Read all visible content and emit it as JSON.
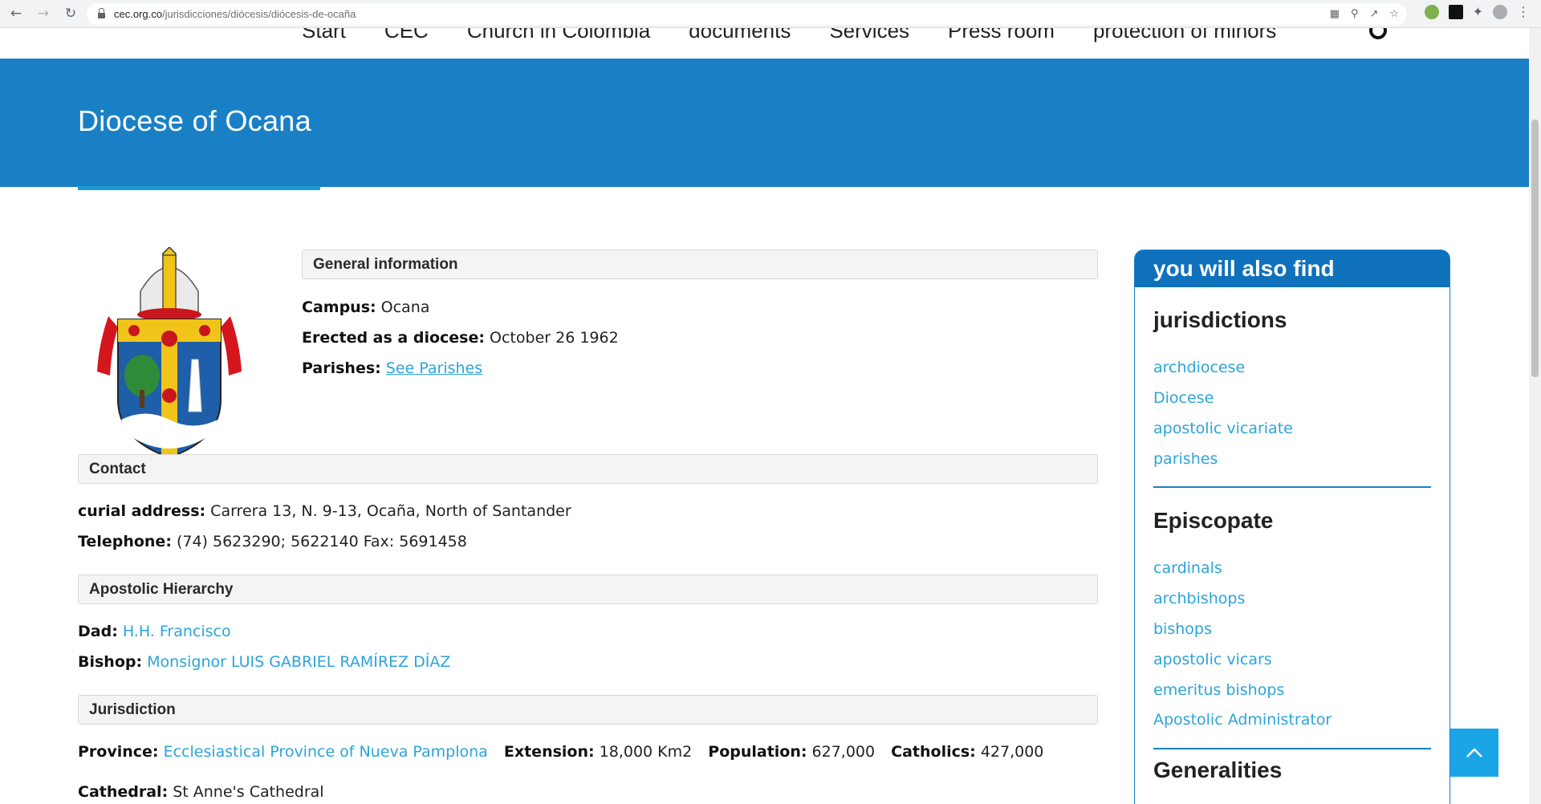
{
  "browser": {
    "url_host": "cec.org.co",
    "url_path": "/jurisdicciones/diócesis/diócesis-de-ocaña"
  },
  "nav": {
    "items": [
      "Start",
      "CEC",
      "Church in Colombia",
      "documents",
      "Services",
      "Press room",
      "protection of minors"
    ]
  },
  "hero": {
    "title": "Diocese of Ocana"
  },
  "general": {
    "heading": "General information",
    "campus_label": "Campus:",
    "campus_value": "Ocana",
    "erected_label": "Erected as a diocese:",
    "erected_value": "October 26 1962",
    "parishes_label": "Parishes:",
    "parishes_link": "See Parishes"
  },
  "contact": {
    "heading": "Contact",
    "address_label": "curial address:",
    "address_value": "Carrera 13, N. 9-13, Ocaña, North of Santander",
    "phone_label": "Telephone:",
    "phone_value": "(74) 5623290; 5622140 Fax: 5691458"
  },
  "hierarchy": {
    "heading": "Apostolic Hierarchy",
    "dad_label": "Dad:",
    "dad_value": "H.H. Francisco",
    "bishop_label": "Bishop:",
    "bishop_value": "Monsignor LUIS GABRIEL RAMÍREZ DÍAZ"
  },
  "jurisdiction": {
    "heading": "Jurisdiction",
    "province_label": "Province:",
    "province_value": "Ecclesiastical Province of Nueva Pamplona",
    "extension_label": "Extension:",
    "extension_value": "18,000 Km2",
    "population_label": "Population:",
    "population_value": "627,000",
    "catholics_label": "Catholics:",
    "catholics_value": "427,000",
    "cathedral_label": "Cathedral:",
    "cathedral_value": "St Anne's Cathedral"
  },
  "sidebar": {
    "heading": "you will also find",
    "jurisdictions_title": "jurisdictions",
    "jurisdictions": [
      "archdiocese",
      "Diocese",
      "apostolic vicariate",
      "parishes"
    ],
    "episcopate_title": "Episcopate",
    "episcopate": [
      "cardinals",
      "archbishops",
      "bishops",
      "apostolic vicars",
      "emeritus bishops",
      "Apostolic Administrator"
    ],
    "generalities_title": "Generalities"
  },
  "colors": {
    "hero": "#1a80c6",
    "link": "#2ba4db",
    "sidebar_head": "#0f71bc"
  }
}
